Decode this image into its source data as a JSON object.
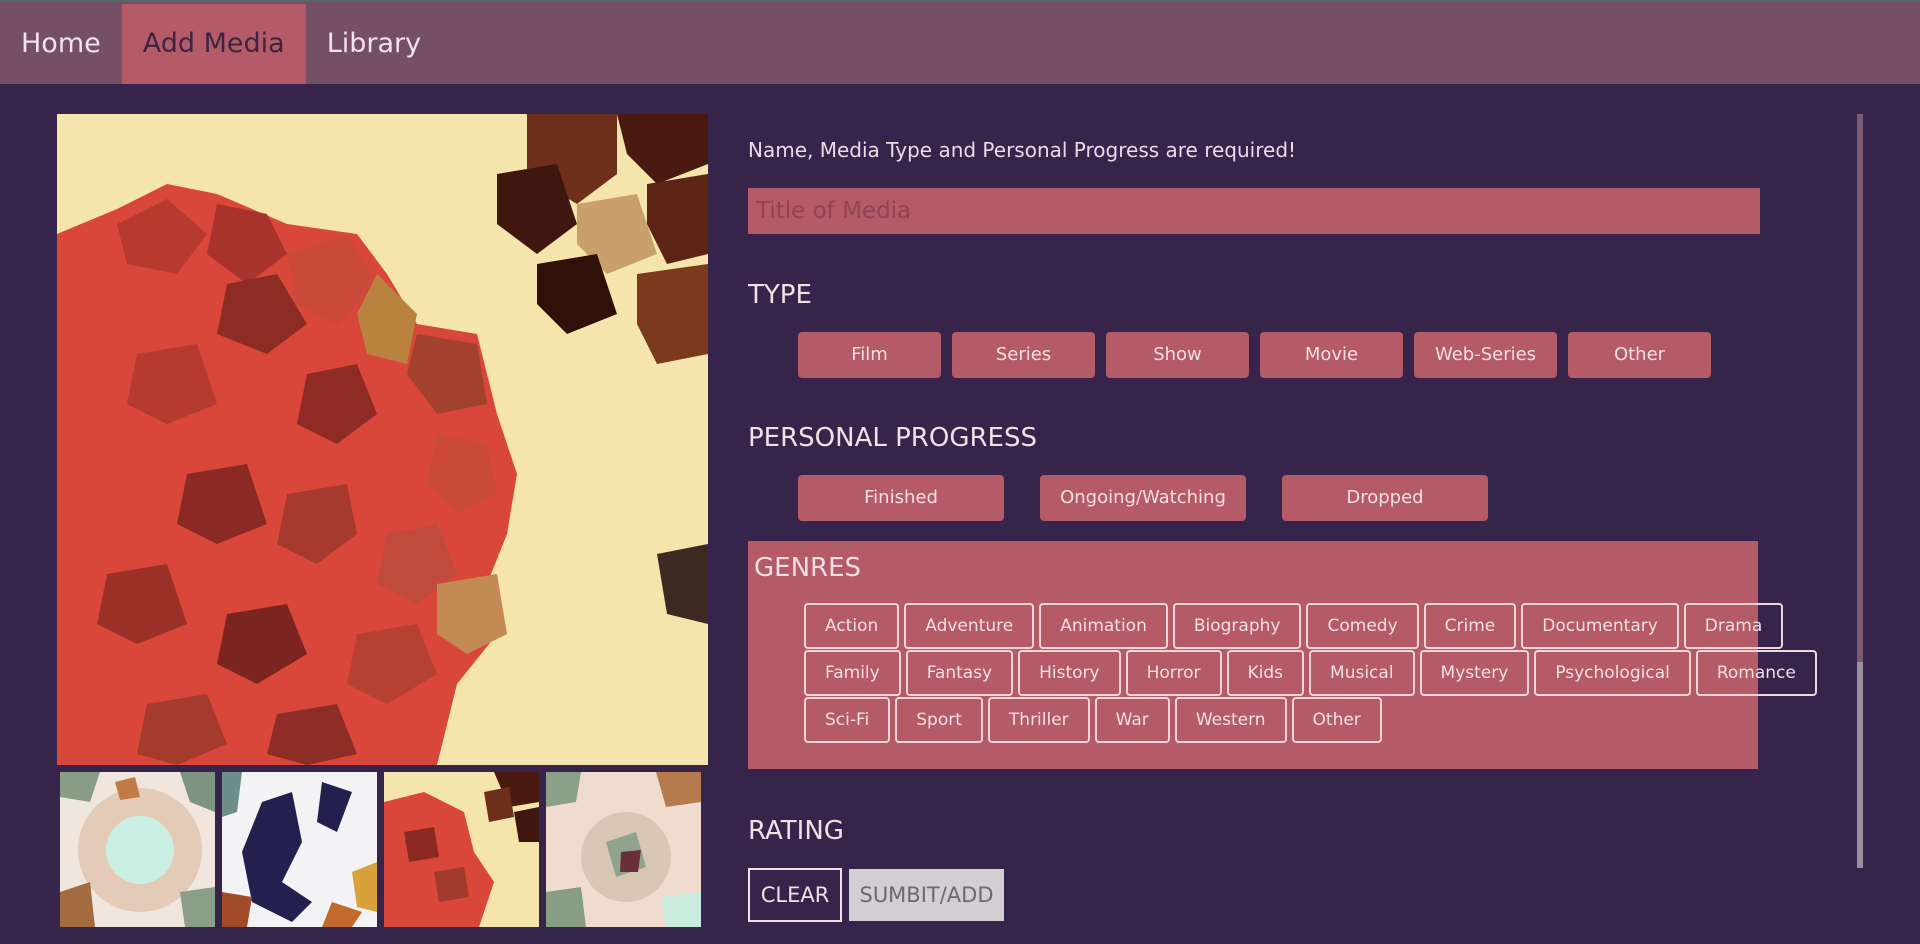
{
  "nav": {
    "items": [
      {
        "label": "Home"
      },
      {
        "label": "Add Media"
      },
      {
        "label": "Library"
      }
    ],
    "active": "Add Media"
  },
  "form": {
    "required_notice": "Name, Media Type and Personal Progress are required!",
    "title_placeholder": "Title of Media",
    "type_heading": "TYPE",
    "types": [
      "Film",
      "Series",
      "Show",
      "Movie",
      "Web-Series",
      "Other"
    ],
    "progress_heading": "PERSONAL PROGRESS",
    "progress_options": [
      "Finished",
      "Ongoing/Watching",
      "Dropped"
    ],
    "genres_heading": "GENRES",
    "genres": [
      [
        "Action",
        "Adventure",
        "Animation",
        "Biography",
        "Comedy",
        "Crime",
        "Documentary",
        "Drama"
      ],
      [
        "Family",
        "Fantasy",
        "History",
        "Horror",
        "Kids",
        "Musical",
        "Mystery",
        "Psychological",
        "Romance"
      ],
      [
        "Sci-Fi",
        "Sport",
        "Thriller",
        "War",
        "Western",
        "Other"
      ]
    ],
    "rating_heading": "RATING",
    "clear_label": "CLEAR",
    "submit_label": "SUMBIT/ADD"
  },
  "colors": {
    "background": "#37244a",
    "topbar": "#754f66",
    "accent": "#b55a67",
    "text": "#f3dfe6"
  }
}
